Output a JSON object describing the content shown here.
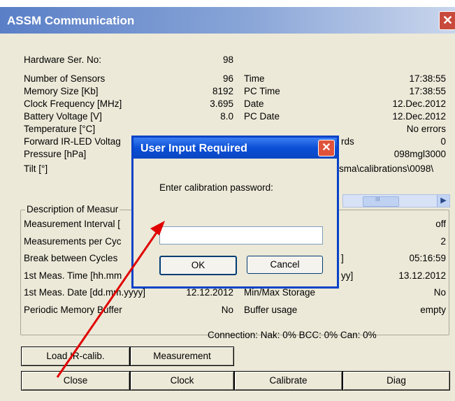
{
  "window": {
    "title": "ASSM Communication",
    "close_glyph": "✕"
  },
  "info_left": [
    {
      "label": "Hardware Ser. No:",
      "value": "98"
    },
    {
      "label": "Number of Sensors",
      "value": "96"
    },
    {
      "label": "Memory Size [Kb]",
      "value": "8192"
    },
    {
      "label": "Clock Frequency [MHz]",
      "value": "3.695"
    },
    {
      "label": "Battery Voltage [V]",
      "value": "8.0"
    },
    {
      "label": "Temperature [°C]"
    },
    {
      "label": "Forward IR-LED Voltag"
    },
    {
      "label": "Pressure [hPa]"
    },
    {
      "label": "Tilt [°]"
    }
  ],
  "info_right": [
    {
      "label": "Time",
      "value": "17:38:55"
    },
    {
      "label": "PC Time",
      "value": "17:38:55"
    },
    {
      "label": "Date",
      "value": "12.Dec.2012"
    },
    {
      "label": "PC Date",
      "value": "12.Dec.2012"
    },
    {
      "value": "No errors"
    },
    {
      "label": "rds",
      "value": "0"
    },
    {
      "value": "098mgl3000"
    },
    {
      "value": "sma\\calibrations\\0098\\"
    }
  ],
  "description": {
    "legend": "Description of Measur",
    "rows_left": [
      {
        "label": "Measurement Interval ["
      },
      {
        "label": "Measurements per Cyc"
      },
      {
        "label": "Break between Cycles"
      },
      {
        "label": "1st Meas. Time [hh.mm"
      },
      {
        "label": "1st Meas. Date [dd.mm.yyyy]",
        "value": "12.12.2012"
      },
      {
        "label": "Periodic Memory Buffer",
        "value": "No"
      }
    ],
    "rows_right": [
      {
        "value": "off"
      },
      {
        "value": "2"
      },
      {
        "label": "]",
        "value": "05:16:59"
      },
      {
        "label": "yy]",
        "value": "13.12.2012"
      },
      {
        "label": "Min/Max Storage",
        "value": "No"
      },
      {
        "label": "Buffer usage",
        "value": "empty"
      }
    ]
  },
  "connection_status": "Connection: Nak:  0% BCC:  0% Can:  0%",
  "buttons": {
    "load_ir_calib": "Load IR-calib.",
    "measurement": "Measurement",
    "close": "Close",
    "clock": "Clock",
    "calibrate": "Calibrate",
    "diag": "Diag"
  },
  "dialog": {
    "title": "User Input Required",
    "close_glyph": "✕",
    "prompt": "Enter calibration password:",
    "password_value": "",
    "ok_label": "OK",
    "cancel_label": "Cancel"
  },
  "scrollbar": {
    "arrow_glyph": "▶",
    "thumb_glyph": "III"
  },
  "annotation": {
    "arrow_color": "#e00000"
  },
  "colors": {
    "window_bg": "#ece9d8",
    "dialog_titlebar": "#0a4fd6",
    "titlebar": "#6a8ccc"
  }
}
